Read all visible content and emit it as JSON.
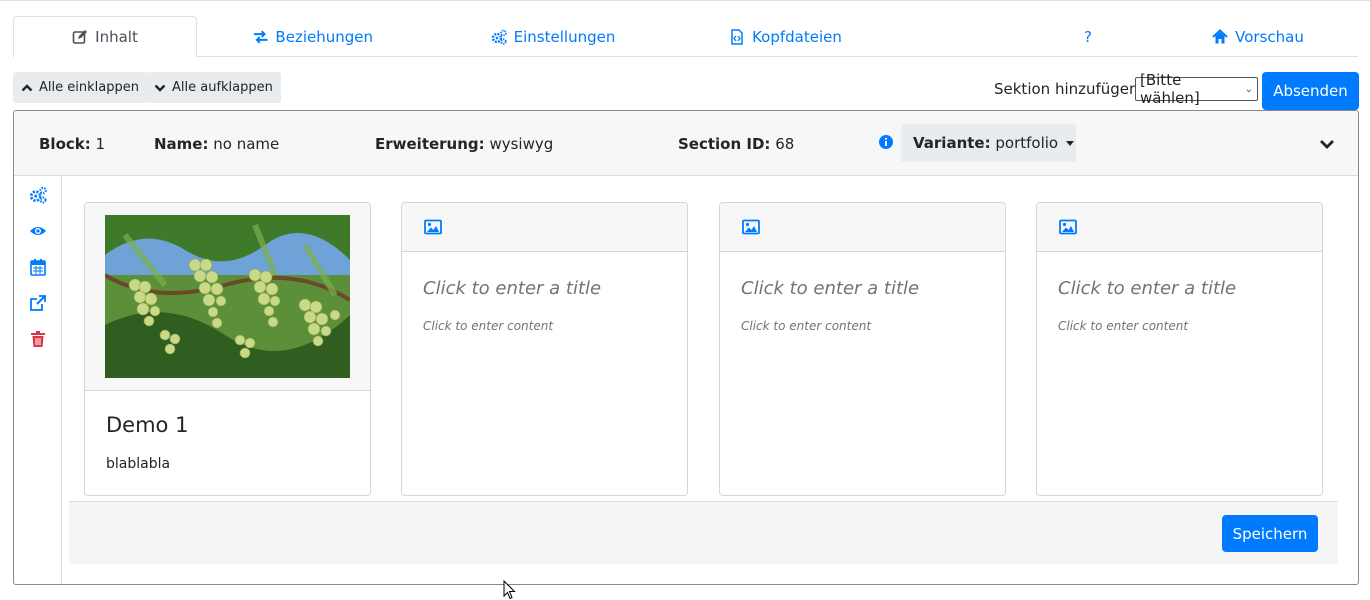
{
  "tabs": [
    {
      "label": "Inhalt",
      "icon": "edit-icon",
      "active": true
    },
    {
      "label": "Beziehungen",
      "icon": "exchange-icon"
    },
    {
      "label": "Einstellungen",
      "icon": "cogs-icon"
    },
    {
      "label": "Kopfdateien",
      "icon": "file-code-icon"
    },
    {
      "label": "?",
      "icon": ""
    },
    {
      "label": "Vorschau",
      "icon": "home-icon"
    }
  ],
  "toolbar": {
    "collapse_all": "Alle einklappen",
    "expand_all": "Alle aufklappen",
    "add_section_label": "Sektion hinzufügen",
    "add_section_select": "[Bitte wählen]",
    "submit": "Absenden"
  },
  "block": {
    "block_label": "Block:",
    "block_value": "1",
    "name_label": "Name:",
    "name_value": "no name",
    "extension_label": "Erweiterung:",
    "extension_value": "wysiwyg",
    "section_label": "Section ID:",
    "section_value": "68",
    "variant_label": "Variante:",
    "variant_value": "portfolio"
  },
  "sidebar_icons": [
    "cogs-icon",
    "eye-icon",
    "calendar-icon",
    "external-link-icon",
    "trash-icon"
  ],
  "cards": [
    {
      "title": "Demo 1",
      "text": "blablabla",
      "image": "grapes"
    },
    {
      "title_placeholder": "Click to enter a title",
      "content_placeholder": "Click to enter content"
    },
    {
      "title_placeholder": "Click to enter a title",
      "content_placeholder": "Click to enter content"
    },
    {
      "title_placeholder": "Click to enter a title",
      "content_placeholder": "Click to enter content"
    }
  ],
  "save_button": "Speichern",
  "colors": {
    "primary": "#007bff",
    "danger": "#dc3545",
    "muted": "#6c757d"
  }
}
